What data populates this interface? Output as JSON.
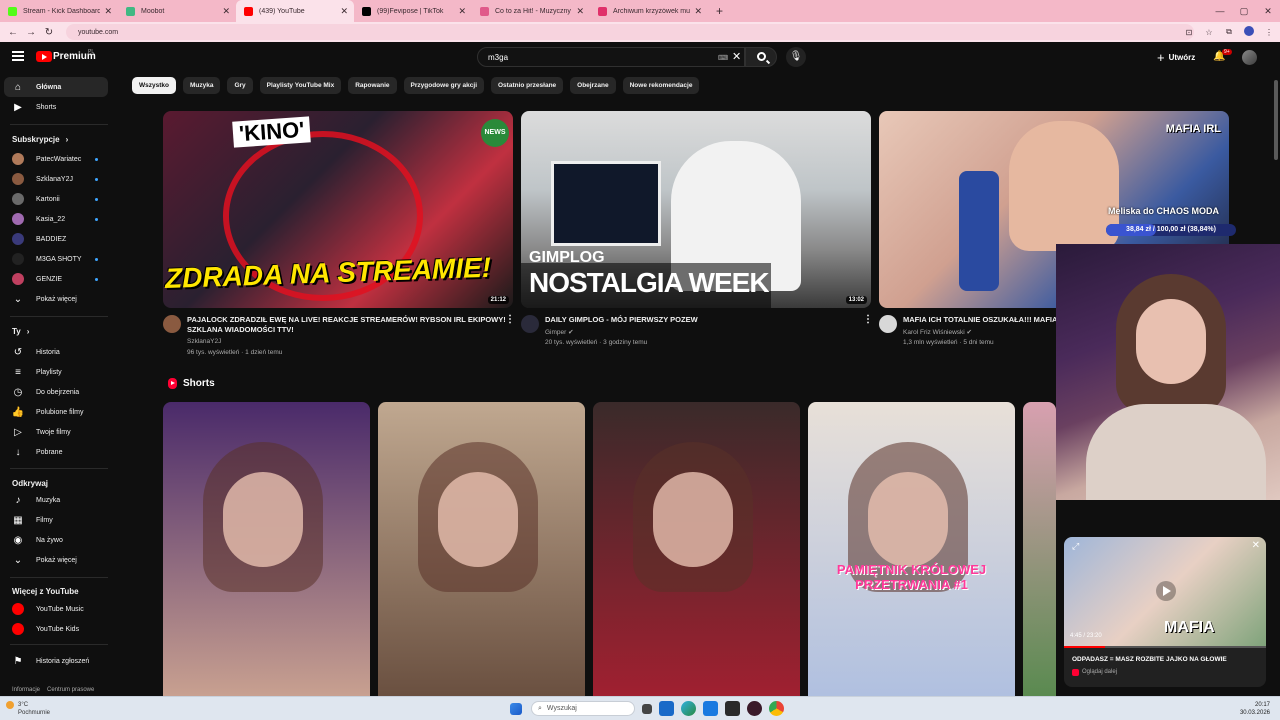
{
  "browser": {
    "tabs": [
      {
        "title": "Stream - Kick Dashboard",
        "color": "#53fc18"
      },
      {
        "title": "Moobot",
        "color": "#41b883"
      },
      {
        "title": "(439) YouTube",
        "color": "#ff0000"
      },
      {
        "title": "(99)Fevipose | TikTok",
        "color": "#000000"
      },
      {
        "title": "Co to za Hit! - Muzyczny Quiz -",
        "color": "#e05a8a"
      },
      {
        "title": "Archiwum krzyżówek muzyczn",
        "color": "#e0306a"
      }
    ],
    "new_tab_label": "+",
    "url": "youtube.com"
  },
  "youtube": {
    "logo_text": "Premium",
    "logo_region": "PL",
    "search_value": "m3ga",
    "create_label": "Utwórz",
    "notif_badge": "9+"
  },
  "sidebar": {
    "main": [
      {
        "label": "Główna",
        "icon": "home-icon",
        "glyph": "⌂",
        "active": true
      },
      {
        "label": "Shorts",
        "icon": "shorts-icon",
        "glyph": "▶",
        "active": false
      }
    ],
    "subs_heading": "Subskrypcje",
    "subs": [
      {
        "label": "PatecWariatec",
        "color": "#b07a5a",
        "live": true
      },
      {
        "label": "SzklanaY2J",
        "color": "#8a5a40",
        "live": true
      },
      {
        "label": "Kartonii",
        "color": "#6a6a6a",
        "live": true
      },
      {
        "label": "Kasia_22",
        "color": "#a06ab0",
        "live": true
      },
      {
        "label": "BADDIEZ",
        "color": "#3a3a7a",
        "live": false
      },
      {
        "label": "M3GA SHOTY",
        "color": "#222222",
        "live": true
      },
      {
        "label": "GENZIE",
        "color": "#c04060",
        "live": true
      }
    ],
    "show_more": "Pokaż więcej",
    "you_heading": "Ty",
    "you": [
      {
        "label": "Historia",
        "icon": "history-icon",
        "glyph": "↺"
      },
      {
        "label": "Playlisty",
        "icon": "playlists-icon",
        "glyph": "≡"
      },
      {
        "label": "Do obejrzenia",
        "icon": "watch-later-icon",
        "glyph": "◷"
      },
      {
        "label": "Polubione filmy",
        "icon": "like-icon",
        "glyph": "👍"
      },
      {
        "label": "Twoje filmy",
        "icon": "your-videos-icon",
        "glyph": "▷"
      },
      {
        "label": "Pobrane",
        "icon": "download-icon",
        "glyph": "↓"
      }
    ],
    "explore_heading": "Odkrywaj",
    "explore": [
      {
        "label": "Muzyka",
        "icon": "music-icon",
        "glyph": "♪"
      },
      {
        "label": "Filmy",
        "icon": "movies-icon",
        "glyph": "▦"
      },
      {
        "label": "Na żywo",
        "icon": "live-icon",
        "glyph": "◉"
      }
    ],
    "show_more_2": "Pokaż więcej",
    "more_heading": "Więcej z YouTube",
    "more": [
      {
        "label": "YouTube Music",
        "color": "#ff0000"
      },
      {
        "label": "YouTube Kids",
        "color": "#ff0000"
      }
    ],
    "report_history": "Historia zgłoszeń",
    "footer1": "Informacje",
    "footer2": "Centrum prasowe"
  },
  "chips": [
    "Wszystko",
    "Muzyka",
    "Gry",
    "Playlisty YouTube Mix",
    "Rapowanie",
    "Przygodowe gry akcji",
    "Ostatnio przesłane",
    "Obejrzane",
    "Nowe rekomendacje"
  ],
  "videos": [
    {
      "title": "PAJALOCK ZDRADZIŁ EWĘ NA LIVE! REAKCJE STREAMERÓW! RYBSON IRL EKIPOWY! SZKLANA WIADOMOŚCI TTV!",
      "channel": "SzklanaY2J",
      "views": "96 tys. wyświetleń · 1 dzień temu",
      "duration": "21:12",
      "thumb_text": "ZDRADA NA STREAMIE!",
      "thumb_text2": "'KINO'",
      "thumb_badge": "NEWS"
    },
    {
      "title": "DAILY GIMPLOG - MÓJ PIERWSZY POZEW",
      "channel": "Gimper ✔",
      "views": "20 tys. wyświetleń · 3 godziny temu",
      "duration": "13:02",
      "thumb_text": "GIMPLOG",
      "thumb_text2": "NOSTALGIA WEEK"
    },
    {
      "title": "MAFIA ICH TOTALNIE OSZUKAŁA!!! MAFIA",
      "channel": "Karol Friz Wiśniewski ✔",
      "views": "1,3 mln wyświetleń · 5 dni temu",
      "duration": "",
      "thumb_text": "MAFIA IRL"
    }
  ],
  "shorts_heading": "Shorts",
  "shorts": [
    {
      "label": "",
      "colors": [
        "#4a2a6a",
        "#c8a090"
      ]
    },
    {
      "label": "",
      "colors": [
        "#c0a890",
        "#6a5040"
      ]
    },
    {
      "label": "",
      "colors": [
        "#3a2a2a",
        "#a02030"
      ]
    },
    {
      "label": "PAMIĘTNIK KRÓLOWEJ PRZETRWANIA #1",
      "colors": [
        "#e8e0d8",
        "#b0c0e0"
      ]
    },
    {
      "label": "",
      "colors": [
        "#d8a0b0",
        "#5a8a50"
      ]
    }
  ],
  "overlay": {
    "goal_title": "Meliska do CHAOS MODA",
    "goal_progress": "38,84 zł / 100,00 zł (38,84%)",
    "goal_fraction": 0.3884
  },
  "miniplayer": {
    "time": "4:45 / 23:20",
    "thumb_text": "MAFIA",
    "title": "ODPADASZ = MASZ ROZBITE JAJKO NA GŁOWIE",
    "sub": "Oglądaj dalej"
  },
  "taskbar": {
    "weather_temp": "3°C",
    "weather_desc": "Pochmurnie",
    "search_placeholder": "Wyszukaj",
    "time": "20:17",
    "date": "30.03.2026"
  }
}
